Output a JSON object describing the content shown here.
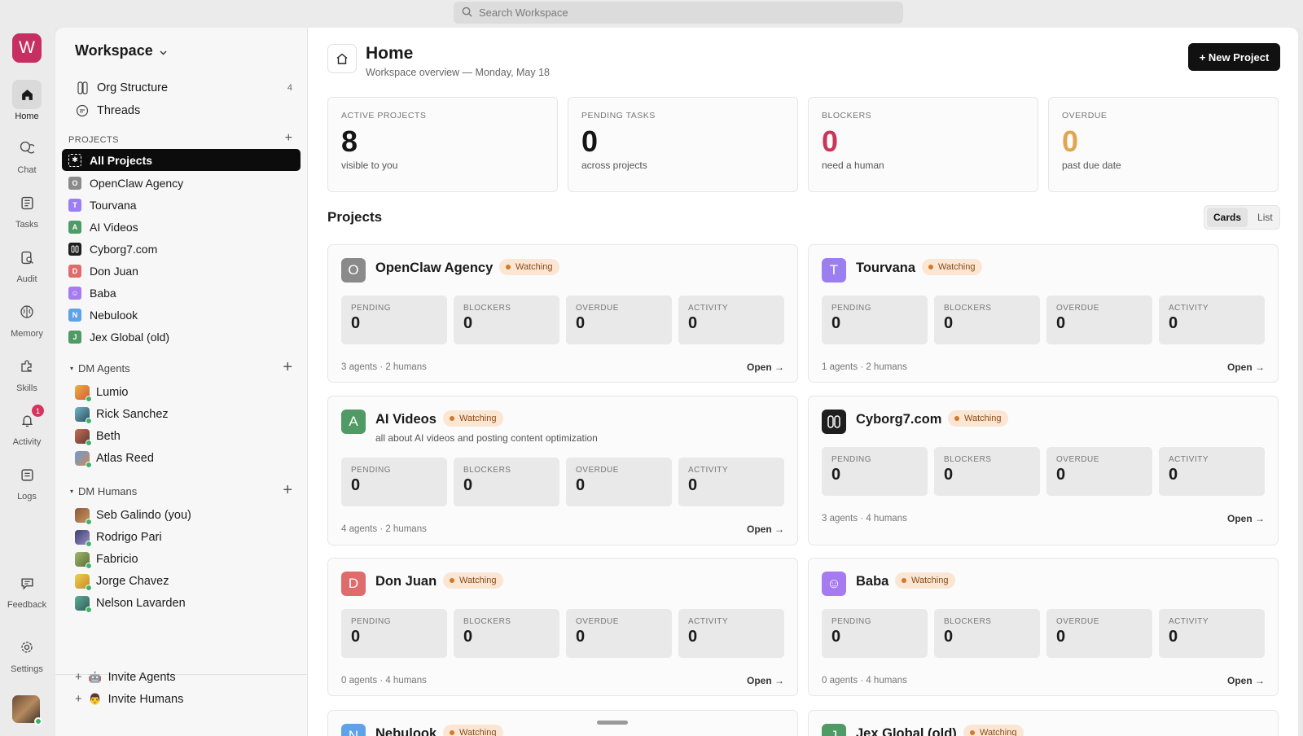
{
  "search": {
    "placeholder": "Search Workspace"
  },
  "rail": {
    "logo": "W",
    "items": [
      {
        "label": "Home",
        "icon": "home-icon"
      },
      {
        "label": "Chat",
        "icon": "chat-icon"
      },
      {
        "label": "Tasks",
        "icon": "tasks-icon"
      },
      {
        "label": "Audit",
        "icon": "audit-icon"
      },
      {
        "label": "Memory",
        "icon": "brain-icon"
      },
      {
        "label": "Skills",
        "icon": "puzzle-icon"
      },
      {
        "label": "Activity",
        "icon": "bell-icon",
        "badge": "1"
      },
      {
        "label": "Logs",
        "icon": "logs-icon"
      },
      {
        "label": "Feedback",
        "icon": "feedback-icon"
      },
      {
        "label": "Settings",
        "icon": "gear-icon"
      }
    ]
  },
  "sidebar": {
    "workspace": "Workspace",
    "org_structure": "Org Structure",
    "org_count": "4",
    "threads": "Threads",
    "projects_label": "PROJECTS",
    "projects": [
      {
        "name": "All Projects",
        "initial": ""
      },
      {
        "name": "OpenClaw Agency",
        "initial": "O",
        "color": "#8a8a8a"
      },
      {
        "name": "Tourvana",
        "initial": "T",
        "color": "#9b7ff0"
      },
      {
        "name": "AI Videos",
        "initial": "A",
        "color": "#4f9a65"
      },
      {
        "name": "Cyborg7.com",
        "initial": "",
        "color": "#1e1e1e"
      },
      {
        "name": "Don Juan",
        "initial": "D",
        "color": "#e06b6b"
      },
      {
        "name": "Baba",
        "initial": "",
        "color": "#a77bf0"
      },
      {
        "name": "Nebulook",
        "initial": "N",
        "color": "#5ea2ea"
      },
      {
        "name": "Jex Global (old)",
        "initial": "J",
        "color": "#4f9a65"
      }
    ],
    "dm_agents_label": "DM Agents",
    "dm_agents": [
      "Lumio",
      "Rick Sanchez",
      "Beth",
      "Atlas Reed"
    ],
    "dm_humans_label": "DM Humans",
    "dm_humans": [
      "Seb Galindo (you)",
      "Rodrigo Pari",
      "Fabricio",
      "Jorge Chavez",
      "Nelson Lavarden"
    ],
    "invite_agents": "Invite Agents",
    "invite_humans": "Invite Humans"
  },
  "header": {
    "title": "Home",
    "subtitle": "Workspace overview — Monday, May 18",
    "new_project": "+ New Project"
  },
  "stats": [
    {
      "label": "ACTIVE PROJECTS",
      "value": "8",
      "sub": "visible to you",
      "color": "#151515"
    },
    {
      "label": "PENDING TASKS",
      "value": "0",
      "sub": "across projects",
      "color": "#151515"
    },
    {
      "label": "BLOCKERS",
      "value": "0",
      "sub": "need a human",
      "color": "#c9365a"
    },
    {
      "label": "OVERDUE",
      "value": "0",
      "sub": "past due date",
      "color": "#e0a64f"
    }
  ],
  "projects_section": {
    "title": "Projects",
    "view_cards": "Cards",
    "view_list": "List",
    "open_label": "Open →",
    "watching_label": "Watching",
    "metric_labels": [
      "PENDING",
      "BLOCKERS",
      "OVERDUE",
      "ACTIVITY"
    ],
    "cards": [
      {
        "name": "OpenClaw Agency",
        "initial": "O",
        "color": "#8a8a8a",
        "desc": "",
        "metrics": [
          "0",
          "0",
          "0",
          "0"
        ],
        "foot": "3 agents · 2 humans"
      },
      {
        "name": "Tourvana",
        "initial": "T",
        "color": "#9b7ff0",
        "desc": "",
        "metrics": [
          "0",
          "0",
          "0",
          "0"
        ],
        "foot": "1 agents · 2 humans"
      },
      {
        "name": "AI Videos",
        "initial": "A",
        "color": "#4f9a65",
        "desc": "all about AI videos and posting content optimization",
        "metrics": [
          "0",
          "0",
          "0",
          "0"
        ],
        "foot": "4 agents · 2 humans"
      },
      {
        "name": "Cyborg7.com",
        "initial": "",
        "color": "#1e1e1e",
        "desc": "",
        "metrics": [
          "0",
          "0",
          "0",
          "0"
        ],
        "foot": "3 agents · 4 humans"
      },
      {
        "name": "Don Juan",
        "initial": "D",
        "color": "#e06b6b",
        "desc": "",
        "metrics": [
          "0",
          "0",
          "0",
          "0"
        ],
        "foot": "0 agents · 4 humans"
      },
      {
        "name": "Baba",
        "initial": "",
        "color": "#a77bf0",
        "desc": "",
        "metrics": [
          "0",
          "0",
          "0",
          "0"
        ],
        "foot": "0 agents · 4 humans"
      },
      {
        "name": "Nebulook",
        "initial": "N",
        "color": "#5ea2ea",
        "desc": "",
        "metrics": [],
        "foot": ""
      },
      {
        "name": "Jex Global (old)",
        "initial": "J",
        "color": "#4f9a65",
        "desc": "",
        "metrics": [],
        "foot": ""
      }
    ]
  }
}
